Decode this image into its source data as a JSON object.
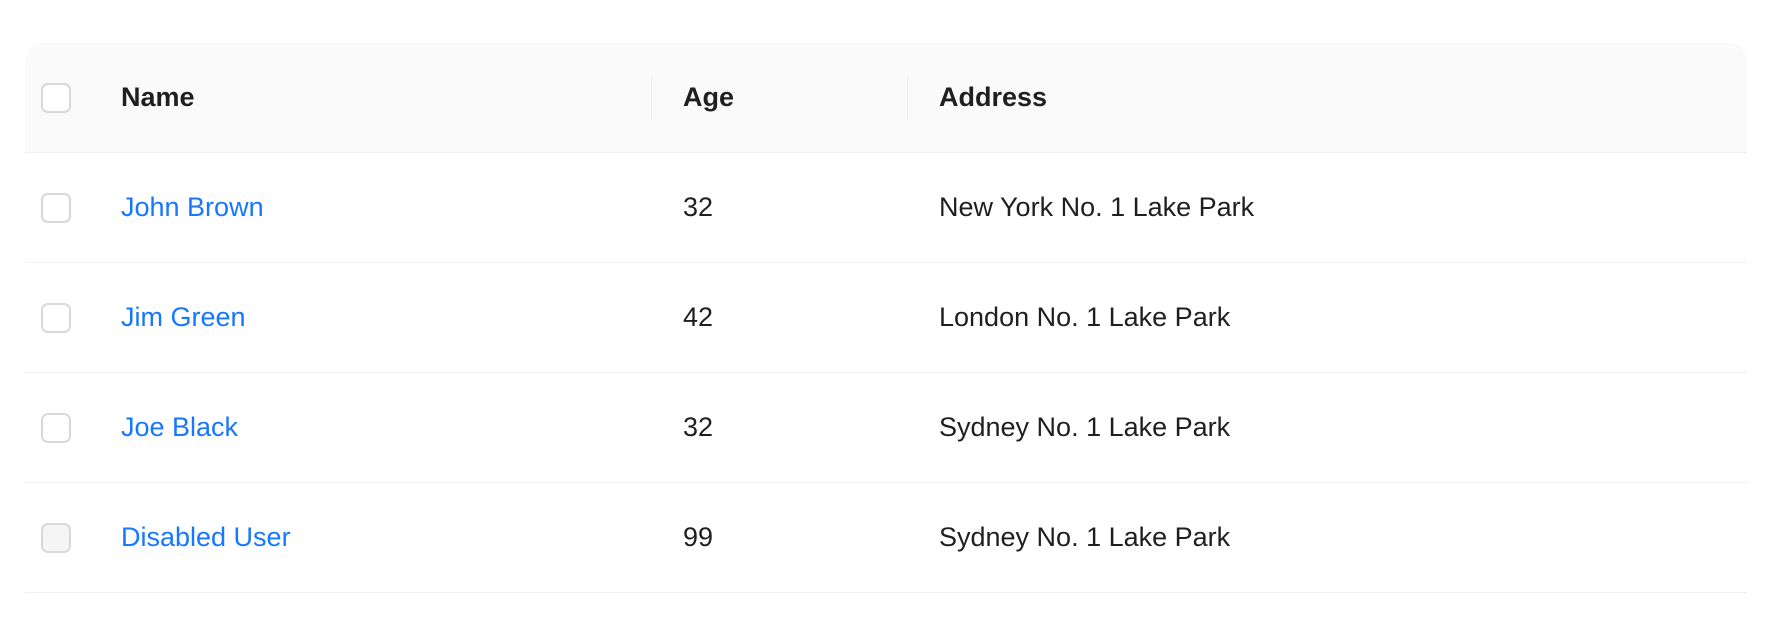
{
  "table": {
    "columns": {
      "name": "Name",
      "age": "Age",
      "address": "Address"
    },
    "rows": [
      {
        "name": "John Brown",
        "age": "32",
        "address": "New York No. 1 Lake Park",
        "disabled": false
      },
      {
        "name": "Jim Green",
        "age": "42",
        "address": "London No. 1 Lake Park",
        "disabled": false
      },
      {
        "name": "Joe Black",
        "age": "32",
        "address": "Sydney No. 1 Lake Park",
        "disabled": false
      },
      {
        "name": "Disabled User",
        "age": "99",
        "address": "Sydney No. 1 Lake Park",
        "disabled": true
      }
    ]
  },
  "colors": {
    "link": "#1677ff",
    "header_bg": "#fafafa",
    "border": "#f0f0f0"
  }
}
